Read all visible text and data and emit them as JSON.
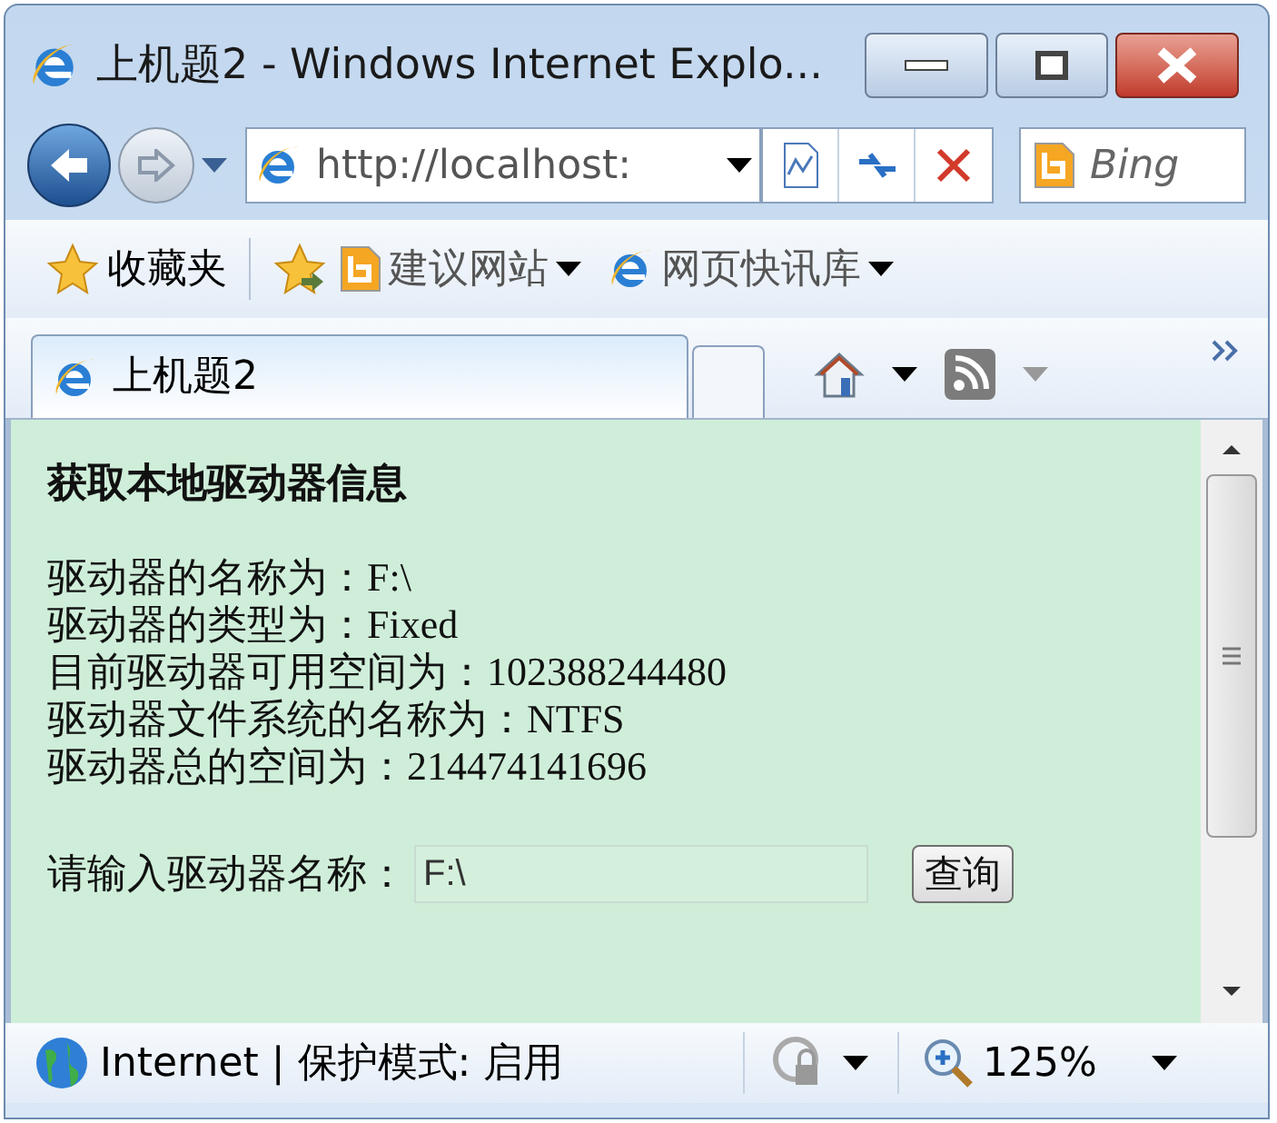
{
  "window": {
    "title": "上机题2 - Windows Internet Explo..."
  },
  "address_bar": {
    "url": "http://localhost:"
  },
  "search": {
    "placeholder": "Bing"
  },
  "favorites_bar": {
    "label": "收藏夹",
    "links": [
      {
        "label": "建议网站",
        "kind": "bing"
      },
      {
        "label": "网页快讯库",
        "kind": "ie"
      }
    ]
  },
  "tabs": [
    {
      "label": "上机题2",
      "selected": true
    }
  ],
  "page": {
    "heading": "获取本地驱动器信息",
    "lines": [
      "驱动器的名称为：F:\\",
      "驱动器的类型为：Fixed",
      "目前驱动器可用空间为：102388244480",
      "驱动器文件系统的名称为：NTFS",
      "驱动器总的空间为：214474141696"
    ],
    "form": {
      "label": "请输入驱动器名称：",
      "value": "F:\\",
      "button": "查询"
    }
  },
  "status_bar": {
    "zone": "Internet | 保护模式: 启用",
    "zoom": "125%"
  }
}
